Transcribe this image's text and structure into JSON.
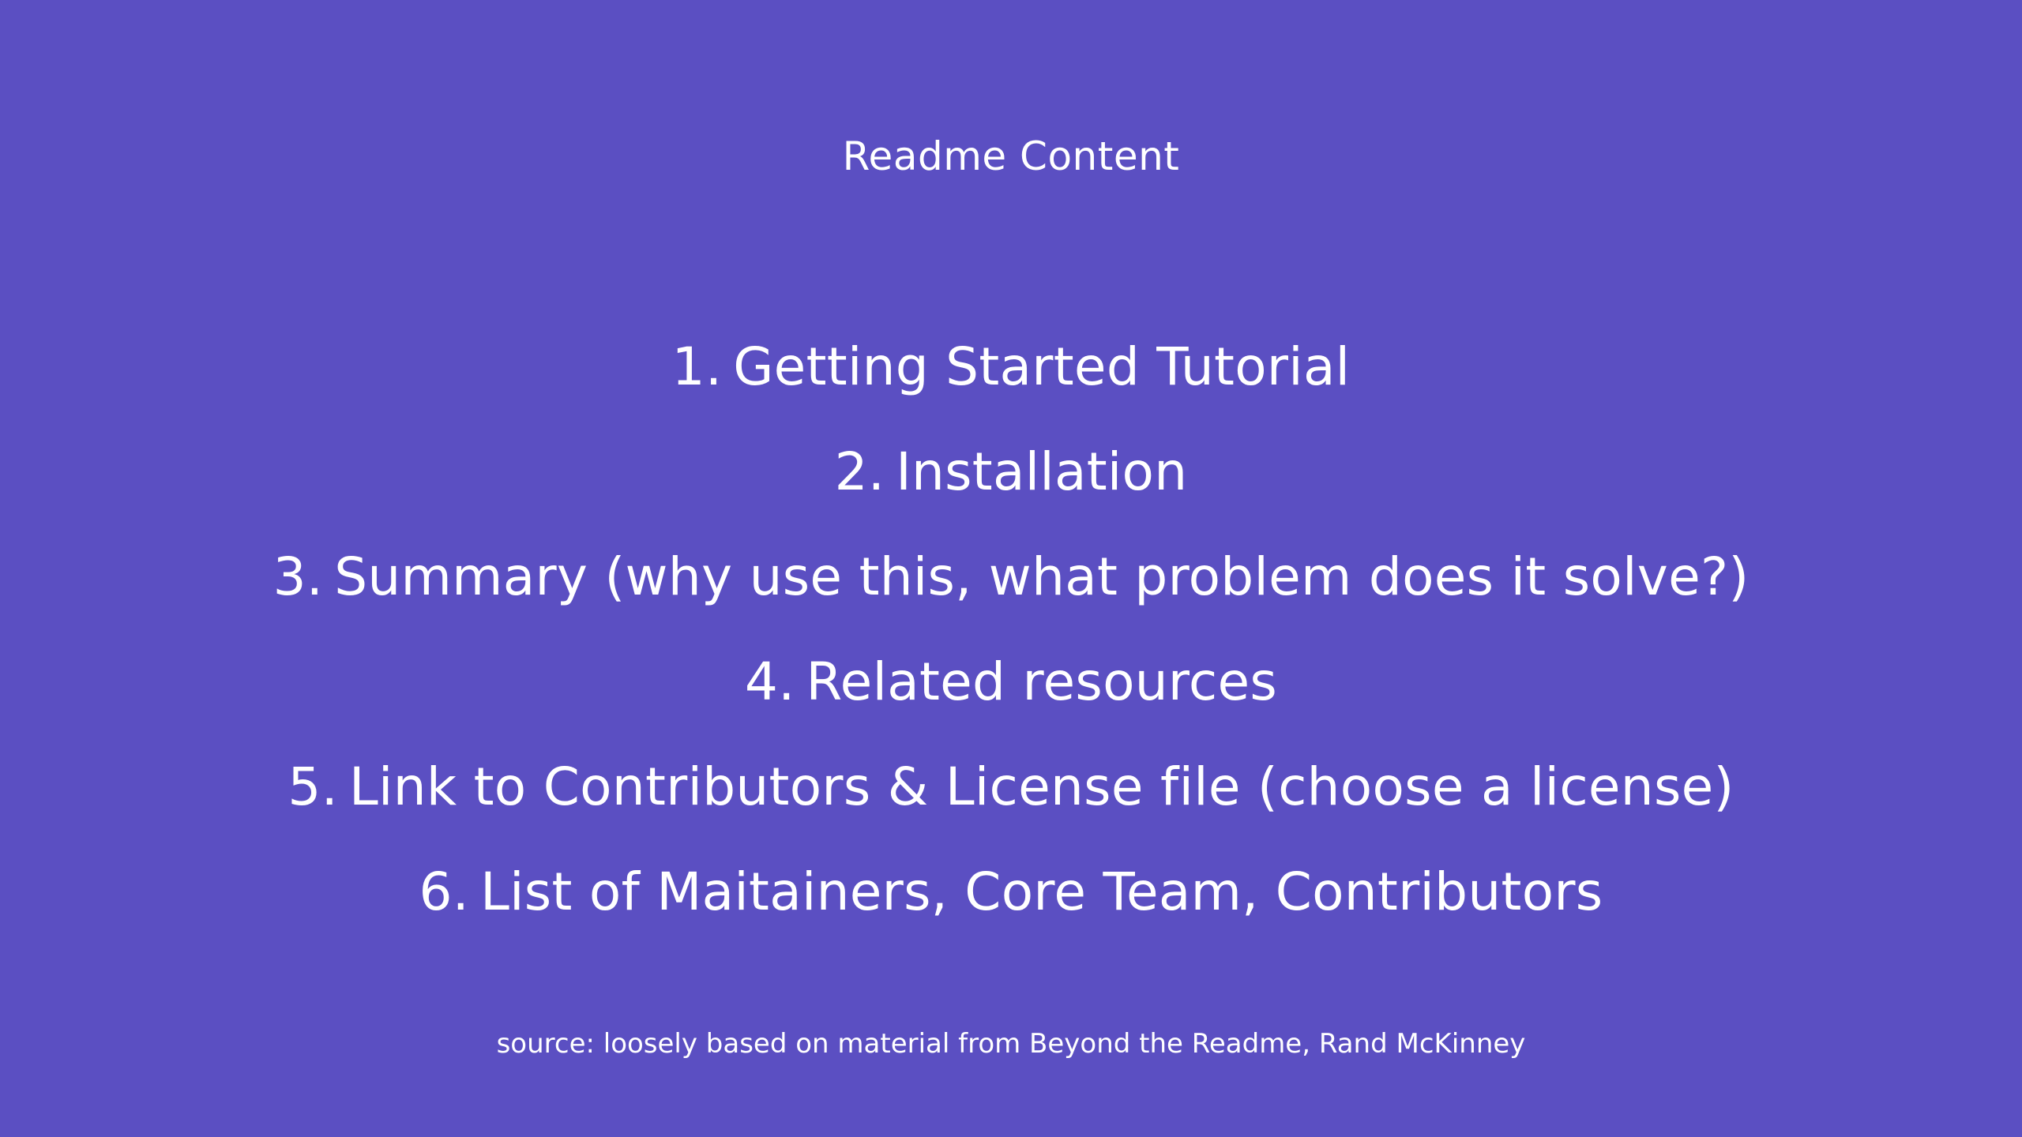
{
  "slide": {
    "background_color": "#5b4fc2",
    "text_color": "#ffffff",
    "title": "Readme Content",
    "items": [
      {
        "number": "1.",
        "text": "Getting Started Tutorial"
      },
      {
        "number": "2.",
        "text": "Installation"
      },
      {
        "number": "3.",
        "text": "Summary (why use this, what problem does it solve?)"
      },
      {
        "number": "4.",
        "text": "Related resources"
      },
      {
        "number": "5.",
        "text": "Link to Contributors & License file (choose a license)"
      },
      {
        "number": "6.",
        "text": "List of Maitainers, Core Team, Contributors"
      }
    ],
    "source": "source: loosely based on material from Beyond the Readme, Rand McKinney"
  }
}
